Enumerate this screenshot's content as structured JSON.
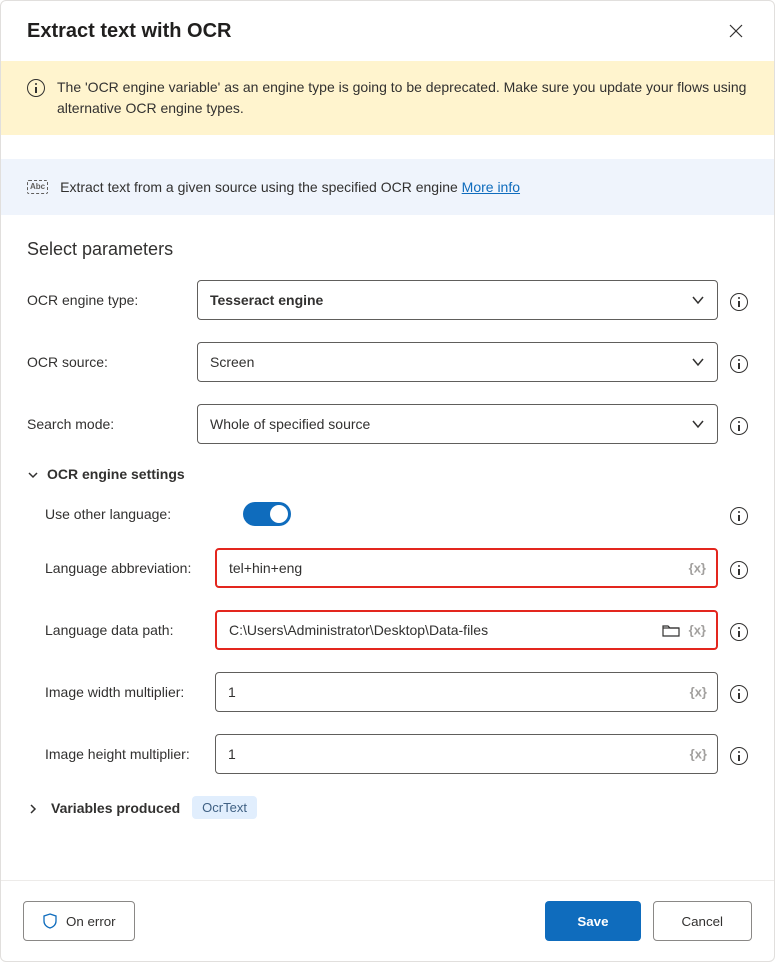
{
  "dialog": {
    "title": "Extract text with OCR"
  },
  "warning": {
    "text": "The 'OCR engine variable' as an engine type is going to be deprecated.  Make sure you update your flows using alternative OCR engine types."
  },
  "description": {
    "text": "Extract text from a given source using the specified OCR engine ",
    "more_info": "More info"
  },
  "section": {
    "title": "Select parameters"
  },
  "fields": {
    "engine_type": {
      "label": "OCR engine type:",
      "value": "Tesseract engine"
    },
    "ocr_source": {
      "label": "OCR source:",
      "value": "Screen"
    },
    "search_mode": {
      "label": "Search mode:",
      "value": "Whole of specified source"
    }
  },
  "group": {
    "label": "OCR engine settings",
    "use_other_language": {
      "label": "Use other language:",
      "value": true
    },
    "lang_abbrev": {
      "label": "Language abbreviation:",
      "value": "tel+hin+eng"
    },
    "lang_path": {
      "label": "Language data path:",
      "value": "C:\\Users\\Administrator\\Desktop\\Data-files"
    },
    "img_width": {
      "label": "Image width multiplier:",
      "value": "1"
    },
    "img_height": {
      "label": "Image height multiplier:",
      "value": "1"
    }
  },
  "variables_produced": {
    "label": "Variables produced",
    "chip": "OcrText"
  },
  "footer": {
    "on_error": "On error",
    "save": "Save",
    "cancel": "Cancel"
  }
}
